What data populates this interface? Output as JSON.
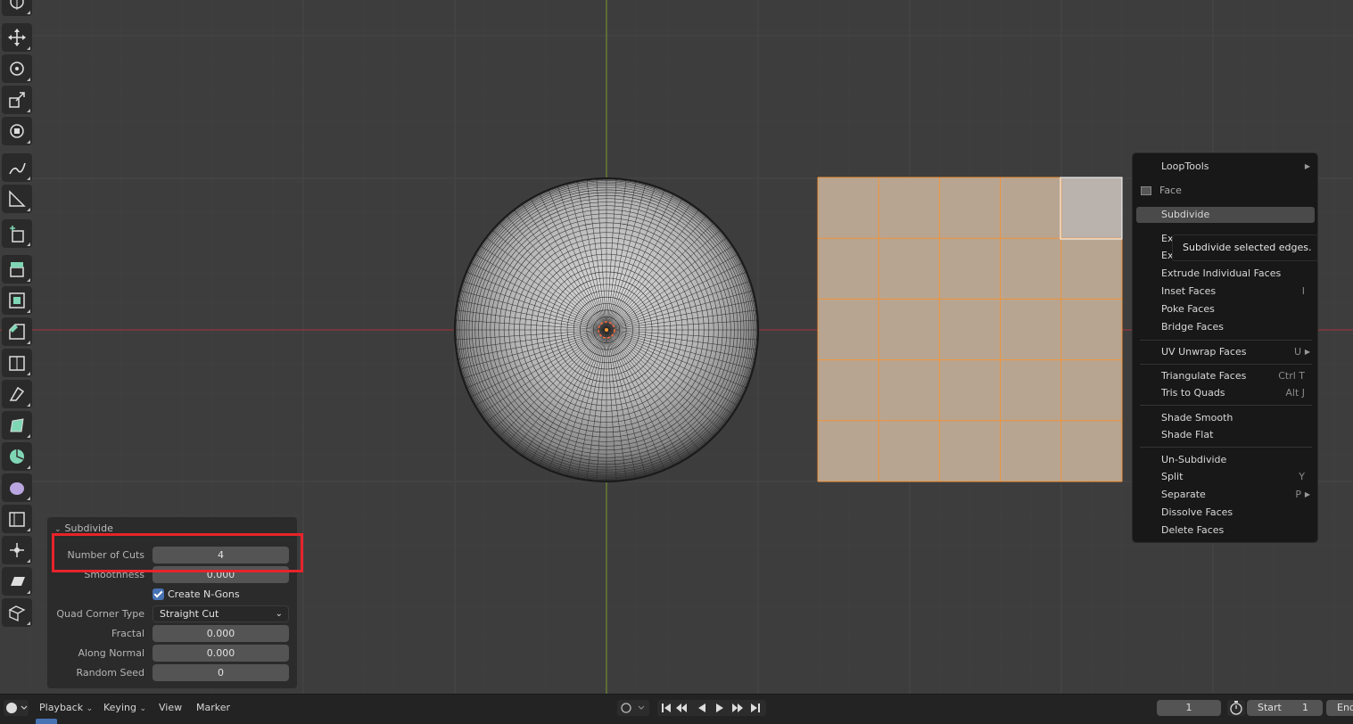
{
  "operator_panel": {
    "title": "Subdivide",
    "number_of_cuts_label": "Number of Cuts",
    "number_of_cuts_value": "4",
    "smoothness_label": "Smoothness",
    "smoothness_value": "0.000",
    "create_ngons_label": "Create N-Gons",
    "create_ngons_checked": true,
    "quad_corner_type_label": "Quad Corner Type",
    "quad_corner_type_value": "Straight Cut",
    "fractal_label": "Fractal",
    "fractal_value": "0.000",
    "along_normal_label": "Along Normal",
    "along_normal_value": "0.000",
    "random_seed_label": "Random Seed",
    "random_seed_value": "0"
  },
  "context_menu": {
    "looptools": "LoopTools",
    "face_header": "Face",
    "subdivide": "Subdivide",
    "extrude_faces_partial": "Ex",
    "extrude_faces_along_partial": "Ex",
    "extrude_individual": "Extrude Individual Faces",
    "inset_faces": "Inset Faces",
    "inset_shortcut": "I",
    "poke_faces": "Poke Faces",
    "bridge_faces": "Bridge Faces",
    "uv_unwrap": "UV Unwrap Faces",
    "uv_unwrap_shortcut": "U",
    "triangulate": "Triangulate Faces",
    "triangulate_shortcut": "Ctrl T",
    "tris_to_quads": "Tris to Quads",
    "tris_to_quads_shortcut": "Alt J",
    "shade_smooth": "Shade Smooth",
    "shade_flat": "Shade Flat",
    "un_subdivide": "Un-Subdivide",
    "split": "Split",
    "split_shortcut": "Y",
    "separate": "Separate",
    "separate_shortcut": "P",
    "dissolve": "Dissolve Faces",
    "delete": "Delete Faces"
  },
  "tooltip": {
    "text": "Subdivide selected edges."
  },
  "timeline": {
    "playback": "Playback",
    "keying": "Keying",
    "view": "View",
    "marker": "Marker",
    "current_frame": "1",
    "start_label": "Start",
    "start_value": "1",
    "end_label_partial": "End"
  },
  "colors": {
    "viewport_bg": "#3d3d3d",
    "selected_face": "#b8a591",
    "selected_edge": "#f0943a",
    "x_axis": "#a8343c",
    "y_axis": "#7a9a2e",
    "highlight_box": "#e8232a",
    "accent_blue": "#4772b3"
  },
  "icons": [
    "select-cursor-icon",
    "move-icon",
    "rotate-icon",
    "scale-icon",
    "transform-icon",
    "annotate-icon",
    "measure-icon",
    "add-cube-icon",
    "extrude-icon",
    "inset-icon",
    "bevel-icon",
    "loop-cut-icon",
    "knife-icon",
    "poly-build-icon",
    "spin-icon",
    "smooth-icon",
    "edge-slide-icon",
    "shrink-fatten-icon",
    "shear-icon",
    "rip-icon"
  ]
}
